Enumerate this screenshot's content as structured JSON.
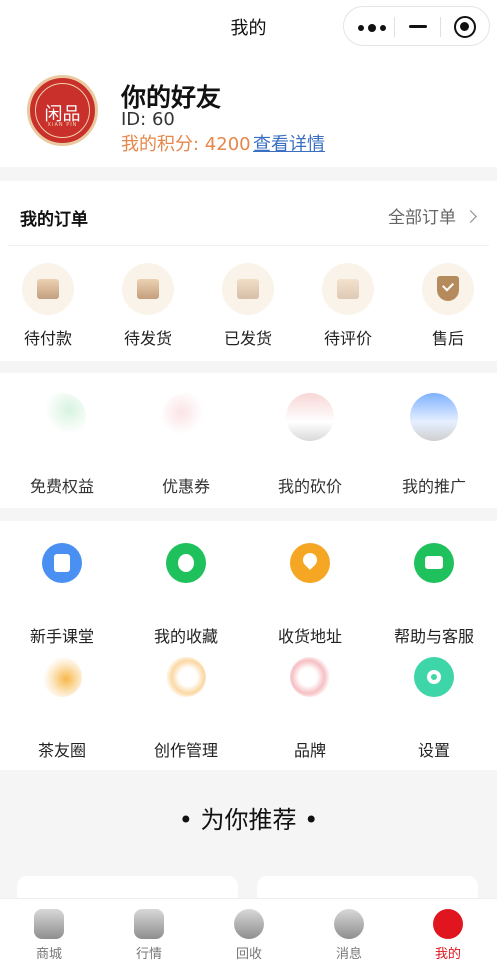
{
  "header": {
    "title": "我的"
  },
  "profile": {
    "name": "你的好友",
    "id_text": "ID:  60",
    "points_text": "我的积分: 4200",
    "detail_link": "查看详情",
    "avatar": {
      "logo_text": "闲品",
      "sub_text": "XIAN PIN"
    }
  },
  "orders": {
    "title": "我的订单",
    "all_label": "全部订单",
    "items": [
      {
        "label": "待付款",
        "icon": "wallet-icon"
      },
      {
        "label": "待发货",
        "icon": "package-icon"
      },
      {
        "label": "已发货",
        "icon": "truck-icon"
      },
      {
        "label": "待评价",
        "icon": "comment-icon"
      },
      {
        "label": "售后",
        "icon": "shield-check-icon"
      }
    ]
  },
  "services": {
    "items": [
      {
        "label": "免费权益",
        "icon": "gift-icon"
      },
      {
        "label": "优惠券",
        "icon": "coupon-icon"
      },
      {
        "label": "我的砍价",
        "icon": "bargain-icon"
      },
      {
        "label": "我的推广",
        "icon": "promote-icon"
      }
    ]
  },
  "tools": {
    "items": [
      {
        "label": "新手课堂",
        "icon": "book-icon",
        "color": "#4a90f2"
      },
      {
        "label": "我的收藏",
        "icon": "star-icon",
        "color": "#1fc15c"
      },
      {
        "label": "收货地址",
        "icon": "location-icon",
        "color": "#f5a623"
      },
      {
        "label": "帮助与客服",
        "icon": "chat-icon",
        "color": "#1fc15c"
      },
      {
        "label": "茶友圈",
        "icon": "circle-icon",
        "color": "#f7b84b"
      },
      {
        "label": "创作管理",
        "icon": "edit-icon",
        "color": "#f7b84b"
      },
      {
        "label": "品牌",
        "icon": "brand-icon",
        "color": "#f07b82"
      },
      {
        "label": "设置",
        "icon": "gear-icon",
        "color": "#3ed6a8"
      }
    ]
  },
  "recommend": {
    "title": "• 为你推荐 •"
  },
  "tabbar": {
    "items": [
      {
        "label": "商城",
        "icon": "shop-icon",
        "active": false
      },
      {
        "label": "行情",
        "icon": "trend-icon",
        "active": false
      },
      {
        "label": "回收",
        "icon": "recycle-icon",
        "active": false
      },
      {
        "label": "消息",
        "icon": "message-icon",
        "active": false
      },
      {
        "label": "我的",
        "icon": "profile-icon",
        "active": true
      }
    ],
    "active_color": "#e0151f"
  }
}
